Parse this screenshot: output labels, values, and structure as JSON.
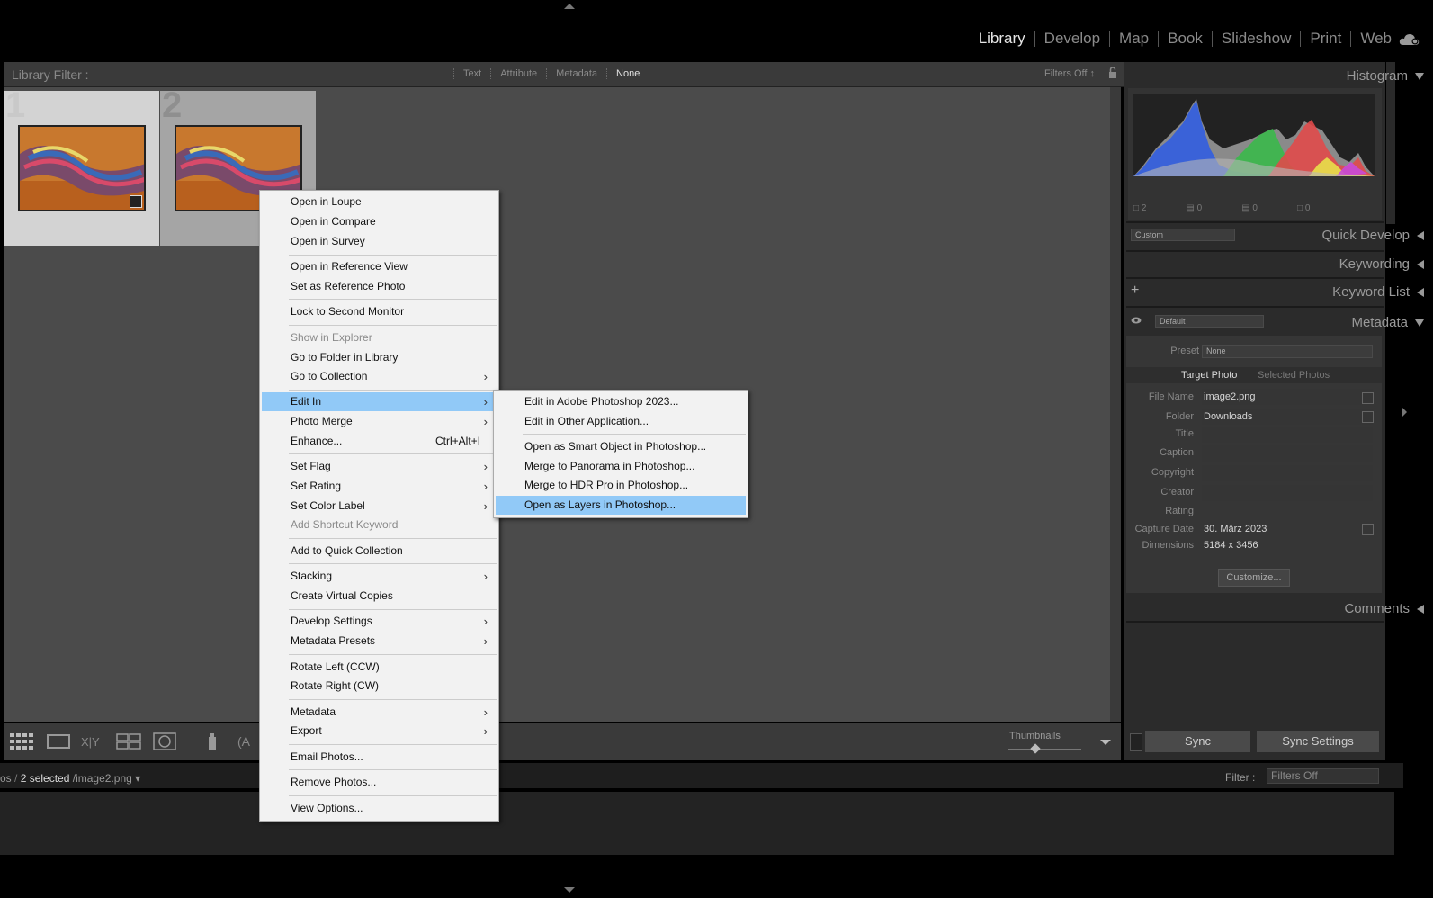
{
  "modules": [
    "Library",
    "Develop",
    "Map",
    "Book",
    "Slideshow",
    "Print",
    "Web"
  ],
  "active_module": "Library",
  "filter_bar": {
    "title": "Library Filter :",
    "tabs": [
      "Text",
      "Attribute",
      "Metadata",
      "None"
    ],
    "active_tab": "None",
    "filters_off": "Filters Off ↕"
  },
  "grid": {
    "cells": [
      {
        "number": "1"
      },
      {
        "number": "2"
      }
    ]
  },
  "toolbar": {
    "thumbnails_label": "Thumbnails"
  },
  "status": {
    "path_prefix": "os",
    "selected": "2 selected",
    "filename": "/image2.png",
    "filter_label": "Filter :",
    "filter_value": "Filters Off"
  },
  "right_panel": {
    "histogram": {
      "title": "Histogram",
      "counts": [
        "2",
        "0",
        "0",
        "0"
      ]
    },
    "quick_develop": {
      "title": "Quick Develop",
      "preset": "Custom"
    },
    "keywording": {
      "title": "Keywording"
    },
    "keyword_list": {
      "title": "Keyword List"
    },
    "metadata": {
      "title": "Metadata",
      "preset_select": "Default",
      "preset_label": "Preset",
      "preset_value": "None",
      "tab_target": "Target Photo",
      "tab_selected": "Selected Photos",
      "fields": {
        "file_name_label": "File Name",
        "file_name": "image2.png",
        "folder_label": "Folder",
        "folder": "Downloads",
        "title_label": "Title",
        "caption_label": "Caption",
        "copyright_label": "Copyright",
        "creator_label": "Creator",
        "rating_label": "Rating",
        "capture_date_label": "Capture Date",
        "capture_date": "30. März 2023",
        "dimensions_label": "Dimensions",
        "dimensions": "5184 x 3456"
      },
      "customize": "Customize..."
    },
    "comments": {
      "title": "Comments"
    },
    "sync": "Sync",
    "sync_settings": "Sync Settings"
  },
  "context_menu": {
    "items": [
      {
        "label": "Open in Loupe"
      },
      {
        "label": "Open in Compare"
      },
      {
        "label": "Open in Survey"
      },
      {
        "label": "Open in Reference View"
      },
      {
        "label": "Set as Reference Photo"
      },
      {
        "label": "Lock to Second Monitor"
      },
      {
        "label": "Show in Explorer",
        "disabled": true
      },
      {
        "label": "Go to Folder in Library"
      },
      {
        "label": "Go to Collection",
        "submenu": true
      },
      {
        "label": "Edit In",
        "submenu": true,
        "highlighted": true
      },
      {
        "label": "Photo Merge",
        "submenu": true
      },
      {
        "label": "Enhance...",
        "shortcut": "Ctrl+Alt+I"
      },
      {
        "label": "Set Flag",
        "submenu": true
      },
      {
        "label": "Set Rating",
        "submenu": true
      },
      {
        "label": "Set Color Label",
        "submenu": true
      },
      {
        "label": "Add Shortcut Keyword",
        "disabled": true
      },
      {
        "label": "Add to Quick Collection"
      },
      {
        "label": "Stacking",
        "submenu": true
      },
      {
        "label": "Create Virtual Copies"
      },
      {
        "label": "Develop Settings",
        "submenu": true
      },
      {
        "label": "Metadata Presets",
        "submenu": true
      },
      {
        "label": "Rotate Left (CCW)"
      },
      {
        "label": "Rotate Right (CW)"
      },
      {
        "label": "Metadata",
        "submenu": true
      },
      {
        "label": "Export",
        "submenu": true
      },
      {
        "label": "Email Photos..."
      },
      {
        "label": "Remove Photos..."
      },
      {
        "label": "View Options..."
      }
    ]
  },
  "submenu": {
    "items": [
      {
        "label": "Edit in Adobe Photoshop 2023..."
      },
      {
        "label": "Edit in Other Application..."
      },
      {
        "label": "Open as Smart Object in Photoshop..."
      },
      {
        "label": "Merge to Panorama in Photoshop..."
      },
      {
        "label": "Merge to HDR Pro in Photoshop..."
      },
      {
        "label": "Open as Layers in Photoshop...",
        "highlighted": true
      }
    ]
  },
  "colors": {
    "menu_highlight": "#91c9f7",
    "panel_bg": "#2b2b2b",
    "grid_bg": "#4b4b4b"
  }
}
